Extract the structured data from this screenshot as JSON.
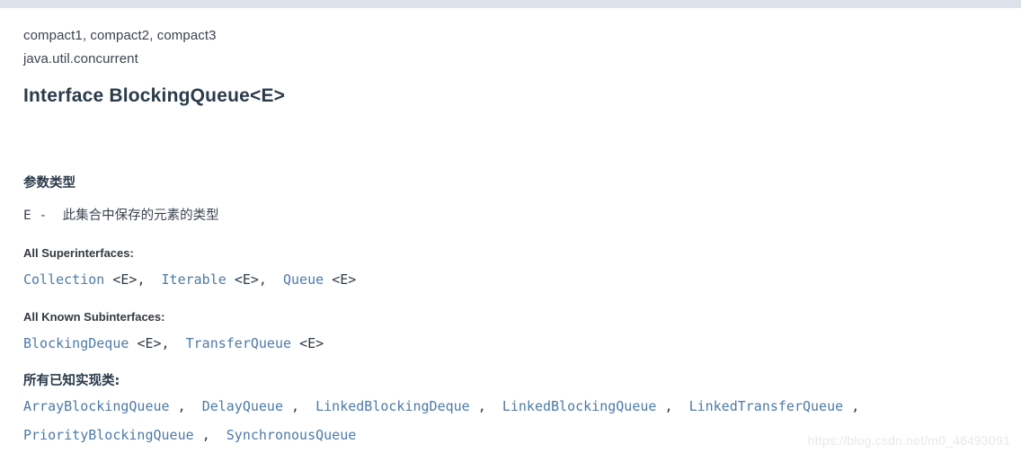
{
  "header": {
    "profiles": "compact1, compact2, compact3",
    "package": "java.util.concurrent",
    "title": "Interface BlockingQueue<E>"
  },
  "type_parameters": {
    "heading": "参数类型",
    "name": "E",
    "dash": "-",
    "description": "此集合中保存的元素的类型"
  },
  "superinterfaces": {
    "heading": "All Superinterfaces:",
    "items": [
      {
        "link": "Collection",
        "generic": "<E>",
        "trailing": ","
      },
      {
        "link": "Iterable",
        "generic": "<E>",
        "trailing": ","
      },
      {
        "link": "Queue",
        "generic": "<E>",
        "trailing": ""
      }
    ]
  },
  "subinterfaces": {
    "heading": "All Known Subinterfaces:",
    "items": [
      {
        "link": "BlockingDeque",
        "generic": "<E>",
        "trailing": ","
      },
      {
        "link": "TransferQueue",
        "generic": "<E>",
        "trailing": ""
      }
    ]
  },
  "implementing_classes": {
    "heading": "所有已知实现类:",
    "rows": [
      [
        {
          "link": "ArrayBlockingQueue",
          "trailing": ","
        },
        {
          "link": "DelayQueue",
          "trailing": ","
        },
        {
          "link": "LinkedBlockingDeque",
          "trailing": ","
        },
        {
          "link": "LinkedBlockingQueue",
          "trailing": ","
        },
        {
          "link": "LinkedTransferQueue",
          "trailing": ","
        }
      ],
      [
        {
          "link": "PriorityBlockingQueue",
          "trailing": ","
        },
        {
          "link": "SynchronousQueue",
          "trailing": ""
        }
      ]
    ]
  },
  "watermark": "https://blog.csdn.net/m0_46493091",
  "colors": {
    "topbar": "#dde1e9",
    "link": "#4d7aa8",
    "text": "#2f3a44",
    "heading": "#2b3a4a",
    "watermark": "#e9e9e9"
  }
}
